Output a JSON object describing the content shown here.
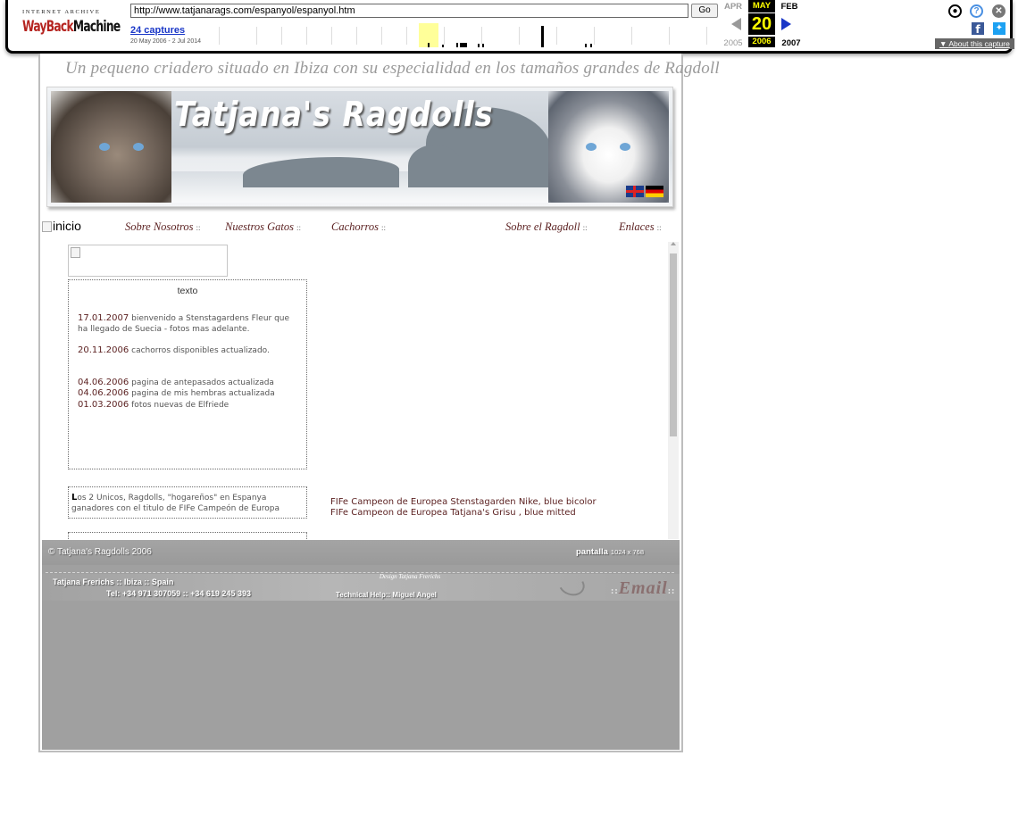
{
  "wayback": {
    "logo_top": "INTERNET ARCHIVE",
    "logo_wayback": "WayBack",
    "logo_machine": "Machine",
    "url": "http://www.tatjanarags.com/espanyol/espanyol.htm",
    "go_label": "Go",
    "captures_label": "24 captures",
    "date_range": "20 May 2006 - 2 Jul 2014",
    "prev_month": "APR",
    "current_month": "MAY",
    "next_month": "FEB",
    "current_day": "20",
    "prev_year": "2005",
    "current_year": "2006",
    "next_year": "2007",
    "about_label": "About this capture",
    "colors": {
      "accent": "#ffff00",
      "link": "#1a37c7",
      "logo_red": "#b5231f"
    },
    "icons": [
      "user-icon",
      "help-icon",
      "close-icon",
      "facebook-icon",
      "twitter-icon"
    ]
  },
  "site": {
    "tagline": "Un pequeno criadero situado en Ibiza con su especialidad en los tamaños grandes de Ragdoll",
    "banner_title": "Tatjana's Ragdolls",
    "nav": {
      "inicio": "inicio",
      "items": [
        "Sobre Nosotros",
        "Nuestros Gatos",
        "Cachorros",
        "Sobre el Ragdoll",
        "Enlaces"
      ],
      "separator": "::"
    },
    "news": {
      "title": "texto",
      "items": [
        {
          "date": "17.01.2007",
          "text": "bienvenido a Stenstagardens Fleur que ha llegado de Suecia - fotos mas adelante."
        },
        {
          "date": "20.11.2006",
          "text": "cachorros disponibles actualizado."
        },
        {
          "date": "04.06.2006",
          "text": "pagina de antepasados actualizada"
        },
        {
          "date": "04.06.2006",
          "text": "pagina de mis hembras actualizada"
        },
        {
          "date": "01.03.2006",
          "text": "fotos nuevas de Elfriede"
        }
      ]
    },
    "champions": {
      "first_letter": "L",
      "text": "os 2 Unicos, Ragdolls, \"hogareños\" en Espanya ganadores con el titulo de FIFe Campeón de Europa"
    },
    "fife_lines": [
      "FIFe Campeon de Europea Stenstagarden Nike, blue bicolor",
      "FIFe Campeon de Europea Tatjana's Grisu , blue mitted"
    ],
    "footer": {
      "copyright": "© Tatjana's Ragdolls 2006",
      "pantalla": "pantalla",
      "resolution": "1024 x 768",
      "contact_name": "Tatjana Frerichs :: Ibiza :: Spain",
      "contact_phone": "Tel: +34 971 307059 :: +34 619 245 393",
      "design_sig": "Design Tatjana Frerichs",
      "tech_help": "Technical Help:: Miguel Angel",
      "email_label": "Email",
      "email_sep": "::"
    },
    "colors": {
      "text_maroon": "#5a1f1f",
      "footer_gray": "#a0a0a0"
    }
  }
}
